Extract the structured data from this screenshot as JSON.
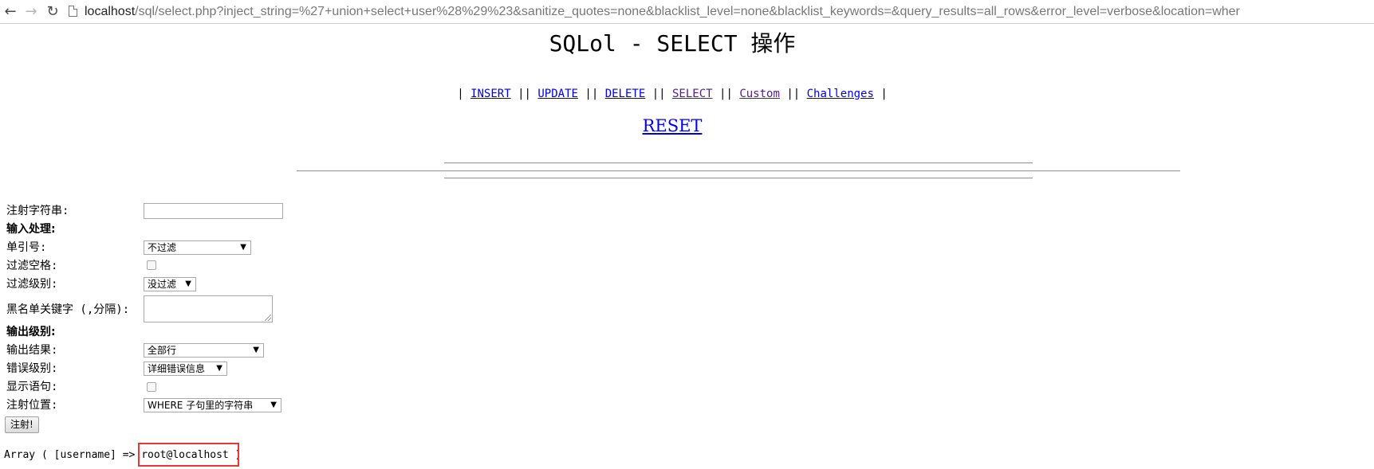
{
  "browser": {
    "url_host": "localhost",
    "url_rest": "/sql/select.php?inject_string=%27+union+select+user%28%29%23&sanitize_quotes=none&blacklist_level=none&blacklist_keywords=&query_results=all_rows&error_level=verbose&location=wher"
  },
  "page": {
    "title": "SQLol - SELECT 操作",
    "nav": [
      {
        "label": "INSERT"
      },
      {
        "label": "UPDATE"
      },
      {
        "label": "DELETE"
      },
      {
        "label": "SELECT"
      },
      {
        "label": "Custom"
      },
      {
        "label": "Challenges"
      }
    ],
    "nav_separator": "||",
    "reset_label": "RESET"
  },
  "form": {
    "inject_string_label": "注射字符串:",
    "inject_string_value": "",
    "input_section": "输入处理:",
    "quotes_label": "单引号:",
    "quotes_value": "不过滤",
    "spaces_label": "过滤空格:",
    "blacklist_level_label": "过滤级别:",
    "blacklist_level_value": "没过滤",
    "blacklist_keywords_label": "黑名单关键字 (,分隔):",
    "output_section": "输出级别:",
    "results_label": "输出结果:",
    "results_value": "全部行",
    "error_label": "错误级别:",
    "error_value": "详细错误信息",
    "show_query_label": "显示语句:",
    "location_label": "注射位置:",
    "location_value": "WHERE 子句里的字符串",
    "submit_label": "注射!"
  },
  "result": {
    "prefix": "Array ( [username] => ",
    "value": "root@localhost",
    "suffix": " )"
  },
  "colors": {
    "link": "#0000ee",
    "visited_link": "#551a8b",
    "highlight_box": "#e53935"
  }
}
